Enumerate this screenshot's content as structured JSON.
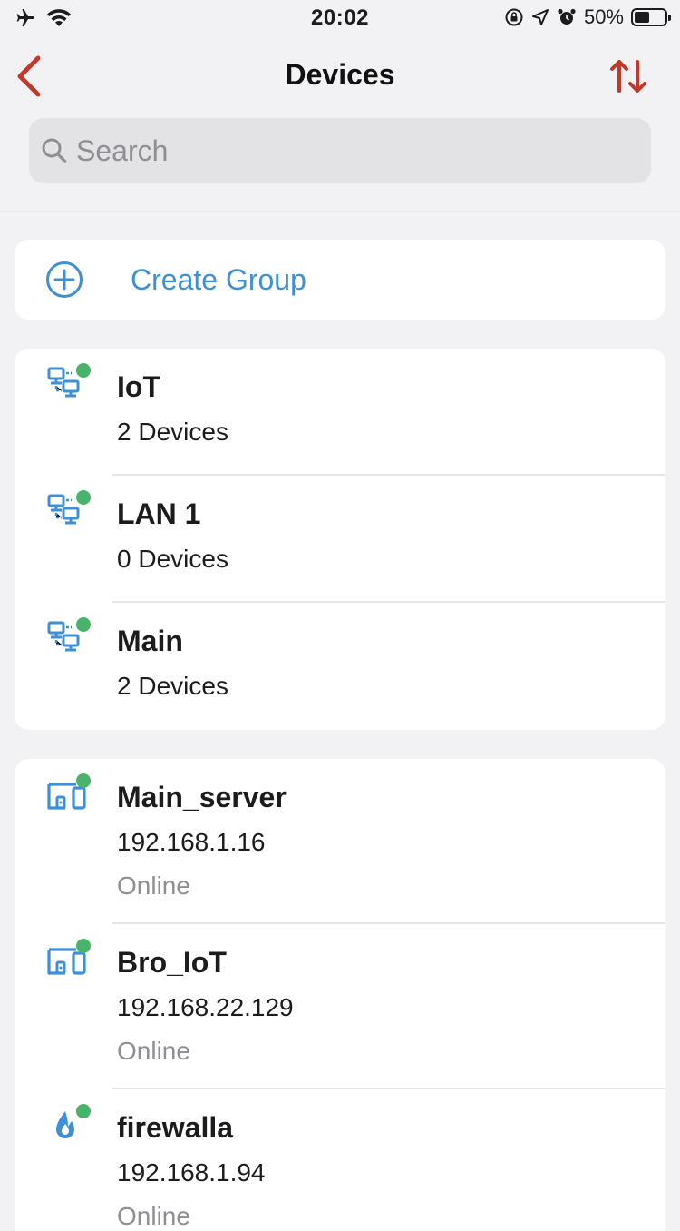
{
  "status_bar": {
    "time": "20:02",
    "battery_percent": "50%",
    "battery_level": 0.5
  },
  "nav": {
    "title": "Devices"
  },
  "search": {
    "placeholder": "Search"
  },
  "create_group": {
    "label": "Create Group"
  },
  "groups": [
    {
      "name": "IoT",
      "count": "2 Devices",
      "online": true
    },
    {
      "name": "LAN 1",
      "count": "0 Devices",
      "online": true
    },
    {
      "name": "Main",
      "count": "2 Devices",
      "online": true
    }
  ],
  "devices": [
    {
      "name": "Main_server",
      "ip": "192.168.1.16",
      "status": "Online",
      "icon": "devices-icon"
    },
    {
      "name": "Bro_IoT",
      "ip": "192.168.22.129",
      "status": "Online",
      "icon": "devices-icon"
    },
    {
      "name": "firewalla",
      "ip": "192.168.1.94",
      "status": "Online",
      "icon": "firewalla-logo-icon"
    }
  ],
  "colors": {
    "accent_red": "#c0392b",
    "link_blue": "#3d8fd6",
    "icon_blue": "#3d8fd6",
    "online_green": "#47b46a"
  }
}
